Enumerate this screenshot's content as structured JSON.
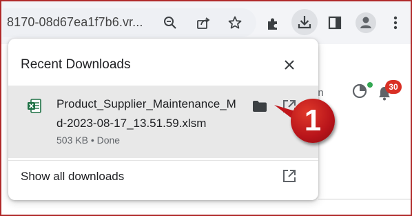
{
  "toolbar": {
    "url_fragment": "8170-08d67ea1f7b6.vr...",
    "icons": [
      "zoom-icon",
      "share-icon",
      "bookmark-star-icon",
      "extensions-icon",
      "download-icon",
      "side-panel-icon",
      "profile-icon",
      "menu-icon"
    ]
  },
  "page": {
    "fragment_text": "in",
    "notification_count": "30",
    "colors": {
      "badge": "#d93025",
      "status_dot": "#34a853"
    }
  },
  "downloads": {
    "title": "Recent Downloads",
    "items": [
      {
        "file_name": "Product_Supplier_Maintenance_Md-2023-08-17_13.51.59.xlsm",
        "status": "503 KB • Done",
        "file_icon": "excel-file-icon"
      }
    ],
    "show_all_label": "Show all downloads"
  },
  "annotation": {
    "label": "1",
    "color": "#c0161b"
  }
}
